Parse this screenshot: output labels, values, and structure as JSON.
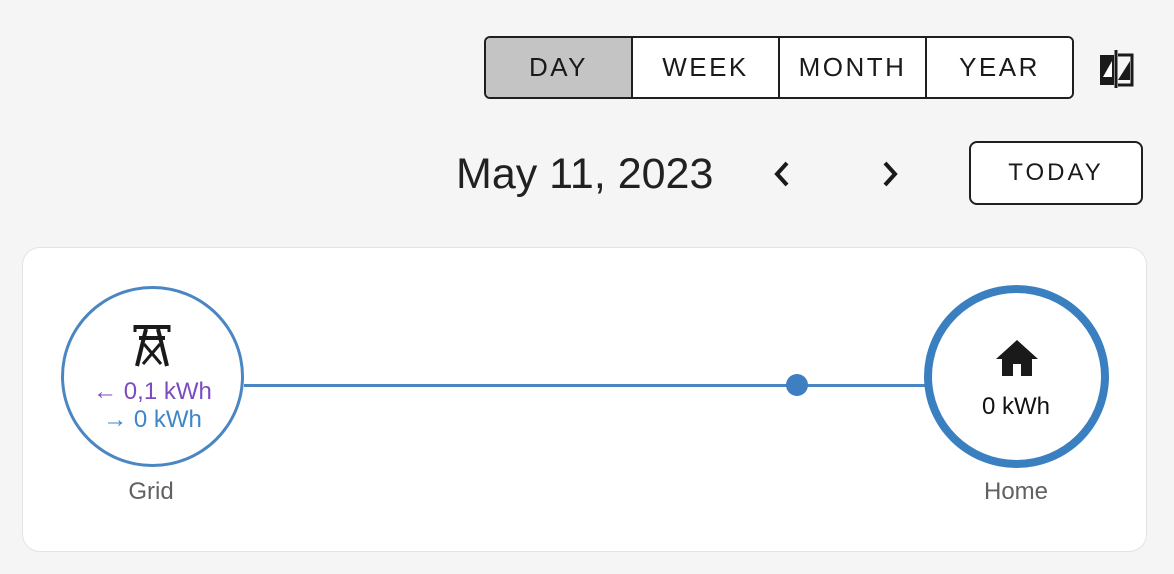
{
  "period": {
    "options": [
      "DAY",
      "WEEK",
      "MONTH",
      "YEAR"
    ],
    "selected": "DAY"
  },
  "compare_icon": "compare-icon",
  "date": {
    "label": "May 11, 2023",
    "prev_icon": "chevron-left-icon",
    "next_icon": "chevron-right-icon",
    "today_label": "TODAY"
  },
  "energy_flow": {
    "grid": {
      "label": "Grid",
      "icon": "transmission-tower-icon",
      "from_grid": "← 0,1 kWh",
      "to_grid": "→ 0 kWh"
    },
    "home": {
      "label": "Home",
      "icon": "home-icon",
      "value": "0 kWh"
    }
  },
  "colors": {
    "flow_line": "#4a86c2",
    "from_grid": "#7c4bc0",
    "to_grid": "#3f86c6",
    "home_ring": "#3a7fc0",
    "selected_tab": "#c4c4c4"
  }
}
